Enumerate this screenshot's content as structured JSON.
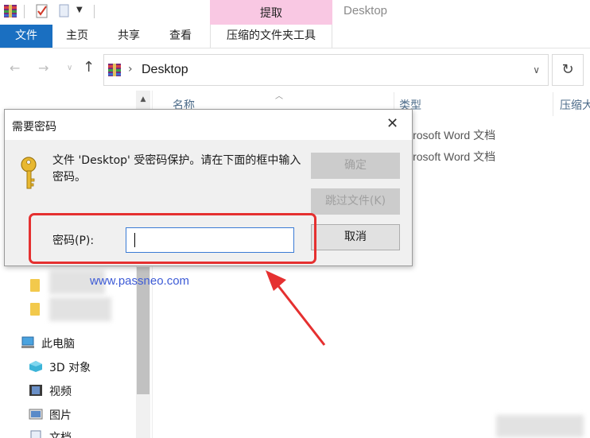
{
  "window": {
    "title": "Desktop",
    "context_tab": "提取"
  },
  "ribbon": {
    "tabs": {
      "file": "文件",
      "home": "主页",
      "share": "共享",
      "view": "查看",
      "compressed_tools": "压缩的文件夹工具"
    }
  },
  "address": {
    "path": "Desktop"
  },
  "columns": {
    "name": "名称",
    "type": "类型",
    "size": "压缩大"
  },
  "rows": [
    {
      "type": "icrosoft Word 文档"
    },
    {
      "type": "icrosoft Word 文档"
    }
  ],
  "nav": {
    "this_pc": "此电脑",
    "objects_3d": "3D 对象",
    "videos": "视频",
    "pictures": "图片",
    "documents": "文档"
  },
  "dialog": {
    "title": "需要密码",
    "message": "文件 'Desktop' 受密码保护。请在下面的框中输入密码。",
    "ok_label": "确定",
    "skip_label": "跳过文件(K)",
    "cancel_label": "取消",
    "password_label": "密码(P):",
    "password_value": ""
  },
  "watermark": "www.passneo.com",
  "colors": {
    "accent": "#1a6fc1",
    "context_tab": "#f9c8e3",
    "annotation": "#e53030",
    "watermark": "#3d5bd6"
  },
  "icons": [
    "winrar-icon",
    "checkmark-doc-icon",
    "document-icon",
    "back-arrow-icon",
    "forward-arrow-icon",
    "up-arrow-icon",
    "refresh-icon",
    "key-icon",
    "close-icon",
    "folder-icon",
    "computer-icon",
    "3d-objects-icon",
    "video-icon",
    "picture-icon"
  ]
}
